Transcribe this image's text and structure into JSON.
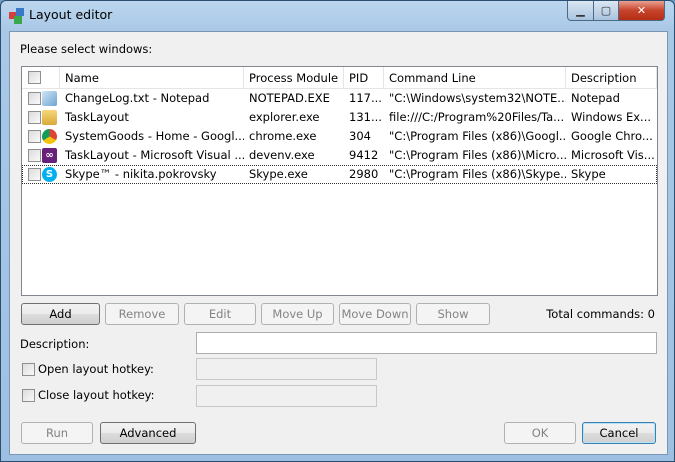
{
  "window": {
    "title": "Layout editor",
    "minimize": "▁",
    "maximize": "▢",
    "close": "✕"
  },
  "prompt": "Please select windows:",
  "columns": [
    "Name",
    "Process Module",
    "PID",
    "Command Line",
    "Description"
  ],
  "rows": [
    {
      "icon": "notepad-icon",
      "name": "ChangeLog.txt - Notepad",
      "module": "NOTEPAD.EXE",
      "pid": "117...",
      "cmd": "\"C:\\Windows\\system32\\NOTE...",
      "desc": "Notepad"
    },
    {
      "icon": "folder-icon",
      "name": "TaskLayout",
      "module": "explorer.exe",
      "pid": "131...",
      "cmd": "file:///C:/Program%20Files/Ta...",
      "desc": "Windows Ex..."
    },
    {
      "icon": "chrome-icon",
      "name": "SystemGoods - Home - Googl...",
      "module": "chrome.exe",
      "pid": "304",
      "cmd": "\"C:\\Program Files (x86)\\Googl...",
      "desc": "Google Chro..."
    },
    {
      "icon": "visual-studio-icon",
      "name": "TaskLayout - Microsoft Visual ...",
      "module": "devenv.exe",
      "pid": "9412",
      "cmd": "\"C:\\Program Files (x86)\\Micro...",
      "desc": "Microsoft Vis..."
    },
    {
      "icon": "skype-icon",
      "name": "Skype™ - nikita.pokrovsky",
      "module": "Skype.exe",
      "pid": "2980",
      "cmd": "\"C:\\Program Files (x86)\\Skype...",
      "desc": "Skype"
    }
  ],
  "buttons": {
    "add": "Add",
    "remove": "Remove",
    "edit": "Edit",
    "move_up": "Move Up",
    "move_down": "Move Down",
    "show": "Show",
    "run": "Run",
    "advanced": "Advanced",
    "ok": "OK",
    "cancel": "Cancel"
  },
  "total_commands": "Total commands: 0",
  "description_label": "Description:",
  "description_value": "",
  "open_hotkey_label": "Open layout hotkey:",
  "close_hotkey_label": "Close layout hotkey:"
}
